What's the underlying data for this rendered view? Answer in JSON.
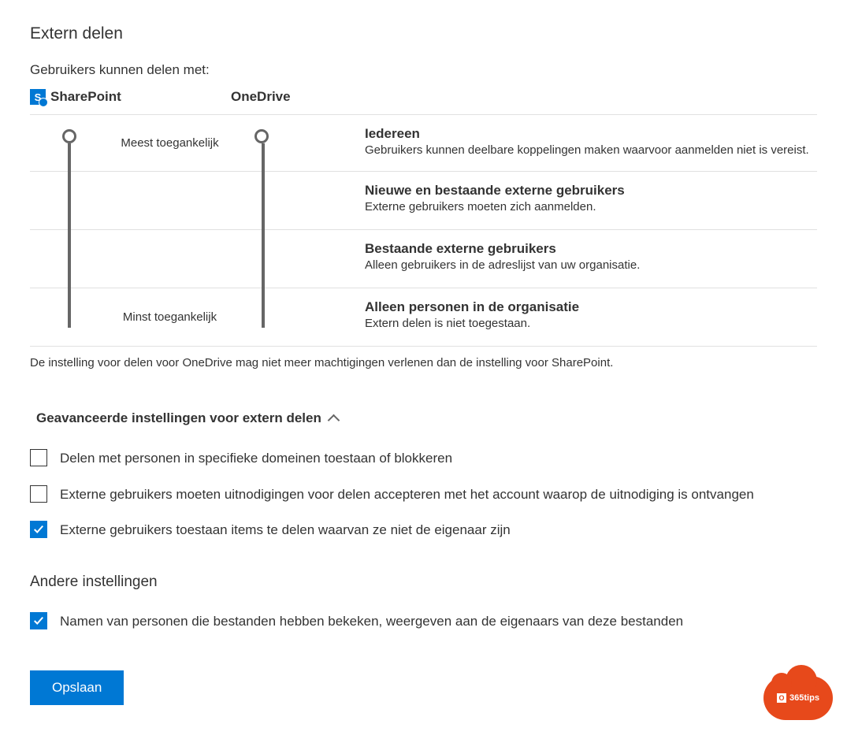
{
  "title": "Extern delen",
  "subtitle": "Gebruikers kunnen delen met:",
  "columns": {
    "sharepoint": "SharePoint",
    "onedrive": "OneDrive"
  },
  "labels": {
    "most": "Meest toegankelijk",
    "least": "Minst toegankelijk"
  },
  "levels": [
    {
      "title": "Iedereen",
      "desc": "Gebruikers kunnen deelbare koppelingen maken waarvoor aanmelden niet is vereist."
    },
    {
      "title": "Nieuwe en bestaande externe gebruikers",
      "desc": "Externe gebruikers moeten zich aanmelden."
    },
    {
      "title": "Bestaande externe gebruikers",
      "desc": "Alleen gebruikers in de adreslijst van uw organisatie."
    },
    {
      "title": "Alleen personen in de organisatie",
      "desc": "Extern delen is niet toegestaan."
    }
  ],
  "footnote": "De instelling voor delen voor OneDrive mag niet meer machtigingen verlenen dan de instelling voor SharePoint.",
  "advanced": {
    "header": "Geavanceerde instellingen voor extern delen",
    "checks": [
      {
        "label": "Delen met personen in specifieke domeinen toestaan of blokkeren",
        "checked": false
      },
      {
        "label": "Externe gebruikers moeten uitnodigingen voor delen accepteren met het account waarop de uitnodiging is ontvangen",
        "checked": false
      },
      {
        "label": "Externe gebruikers toestaan items te delen waarvan ze niet de eigenaar zijn",
        "checked": true
      }
    ]
  },
  "other": {
    "header": "Andere instellingen",
    "checks": [
      {
        "label": "Namen van personen die bestanden hebben bekeken, weergeven aan de eigenaars van deze bestanden",
        "checked": true
      }
    ]
  },
  "save": "Opslaan",
  "badge": "365tips"
}
